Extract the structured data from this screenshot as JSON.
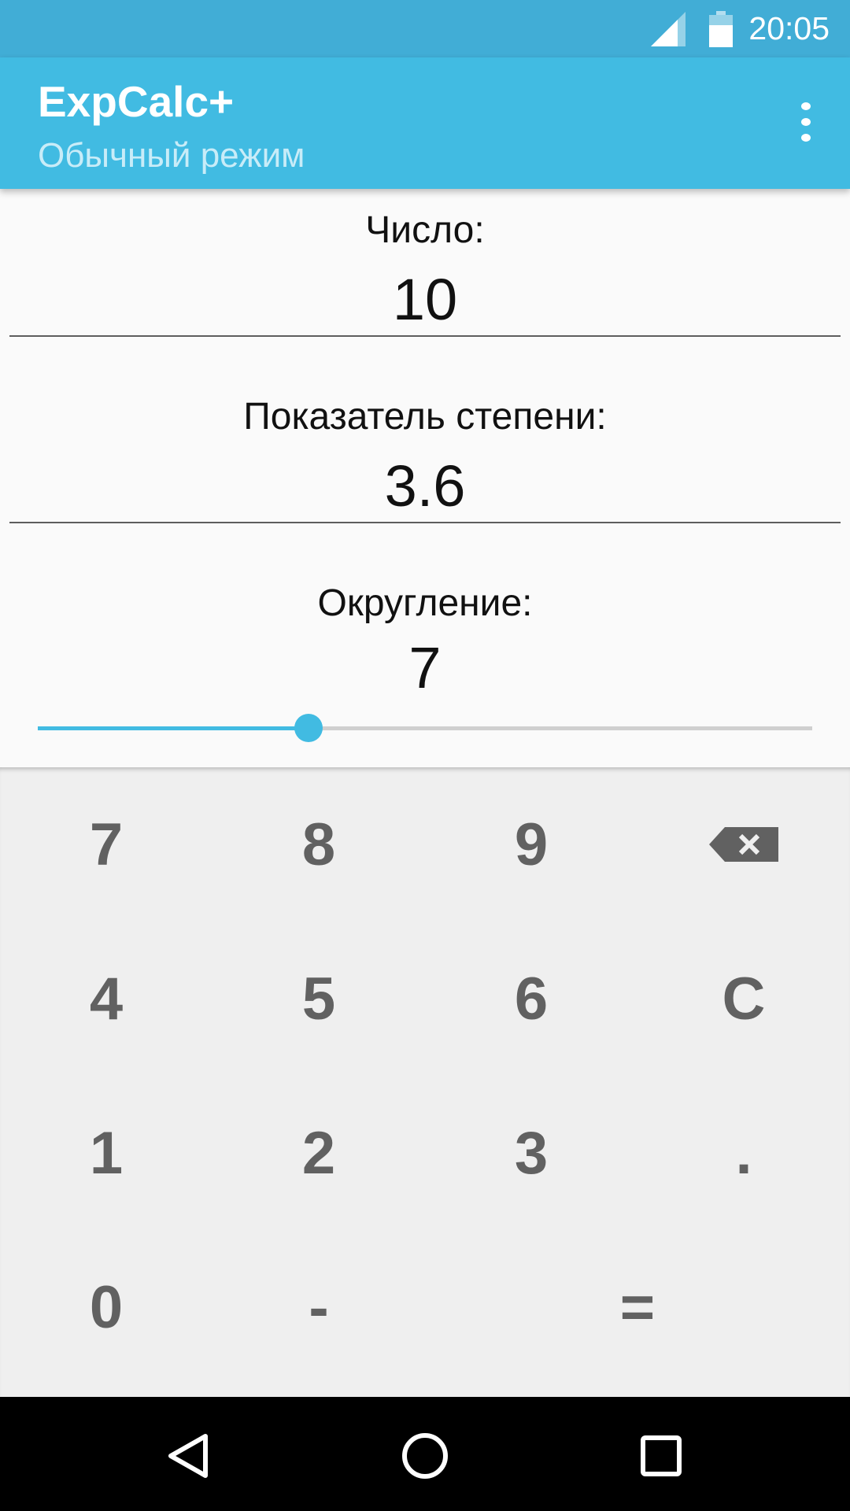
{
  "status_bar": {
    "time": "20:05"
  },
  "app_bar": {
    "title": "ExpCalc+",
    "subtitle": "Обычный режим"
  },
  "form": {
    "number_label": "Число:",
    "number_value": "10",
    "exponent_label": "Показатель степени:",
    "exponent_value": "3.6",
    "rounding_label": "Округление:",
    "rounding_value": "7",
    "rounding_slider_fraction": 0.35
  },
  "keypad": {
    "row1": [
      "7",
      "8",
      "9"
    ],
    "row2": [
      "4",
      "5",
      "6",
      "C"
    ],
    "row3": [
      "1",
      "2",
      "3",
      "."
    ],
    "row4": [
      "0",
      "-",
      "="
    ],
    "backspace_icon": "backspace-icon"
  },
  "colors": {
    "status_bar": "#41add6",
    "app_bar": "#41bbe2",
    "accent": "#41bbe2",
    "key_text": "#616161",
    "keypad_bg": "#efefef"
  }
}
